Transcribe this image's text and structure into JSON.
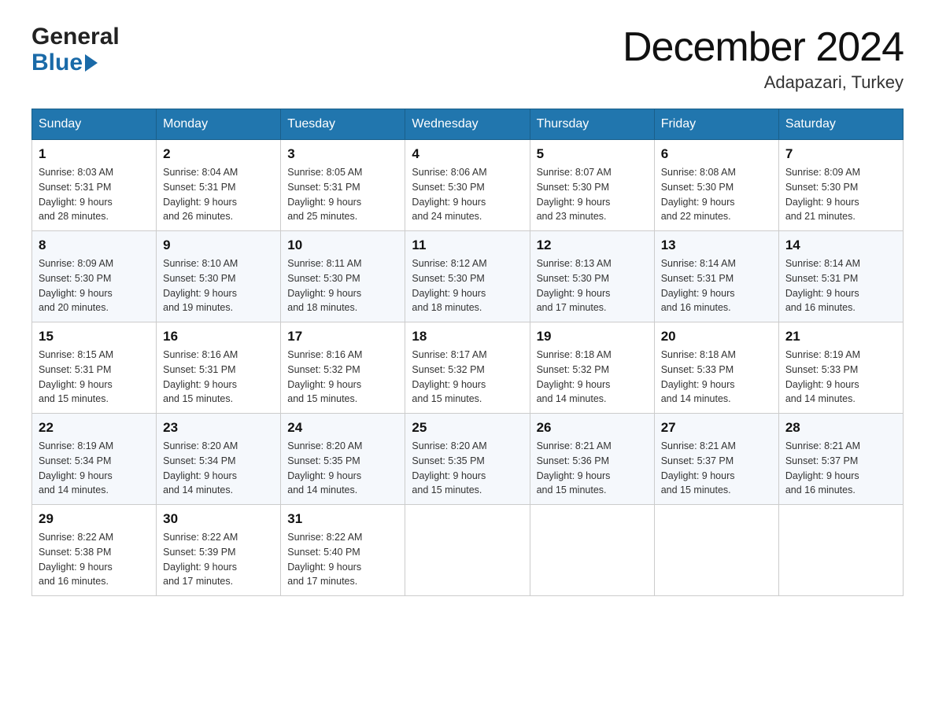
{
  "header": {
    "logo_general": "General",
    "logo_blue": "Blue",
    "month_title": "December 2024",
    "location": "Adapazari, Turkey"
  },
  "days_of_week": [
    "Sunday",
    "Monday",
    "Tuesday",
    "Wednesday",
    "Thursday",
    "Friday",
    "Saturday"
  ],
  "weeks": [
    [
      {
        "day": "1",
        "sunrise": "8:03 AM",
        "sunset": "5:31 PM",
        "daylight": "9 hours and 28 minutes."
      },
      {
        "day": "2",
        "sunrise": "8:04 AM",
        "sunset": "5:31 PM",
        "daylight": "9 hours and 26 minutes."
      },
      {
        "day": "3",
        "sunrise": "8:05 AM",
        "sunset": "5:31 PM",
        "daylight": "9 hours and 25 minutes."
      },
      {
        "day": "4",
        "sunrise": "8:06 AM",
        "sunset": "5:30 PM",
        "daylight": "9 hours and 24 minutes."
      },
      {
        "day": "5",
        "sunrise": "8:07 AM",
        "sunset": "5:30 PM",
        "daylight": "9 hours and 23 minutes."
      },
      {
        "day": "6",
        "sunrise": "8:08 AM",
        "sunset": "5:30 PM",
        "daylight": "9 hours and 22 minutes."
      },
      {
        "day": "7",
        "sunrise": "8:09 AM",
        "sunset": "5:30 PM",
        "daylight": "9 hours and 21 minutes."
      }
    ],
    [
      {
        "day": "8",
        "sunrise": "8:09 AM",
        "sunset": "5:30 PM",
        "daylight": "9 hours and 20 minutes."
      },
      {
        "day": "9",
        "sunrise": "8:10 AM",
        "sunset": "5:30 PM",
        "daylight": "9 hours and 19 minutes."
      },
      {
        "day": "10",
        "sunrise": "8:11 AM",
        "sunset": "5:30 PM",
        "daylight": "9 hours and 18 minutes."
      },
      {
        "day": "11",
        "sunrise": "8:12 AM",
        "sunset": "5:30 PM",
        "daylight": "9 hours and 18 minutes."
      },
      {
        "day": "12",
        "sunrise": "8:13 AM",
        "sunset": "5:30 PM",
        "daylight": "9 hours and 17 minutes."
      },
      {
        "day": "13",
        "sunrise": "8:14 AM",
        "sunset": "5:31 PM",
        "daylight": "9 hours and 16 minutes."
      },
      {
        "day": "14",
        "sunrise": "8:14 AM",
        "sunset": "5:31 PM",
        "daylight": "9 hours and 16 minutes."
      }
    ],
    [
      {
        "day": "15",
        "sunrise": "8:15 AM",
        "sunset": "5:31 PM",
        "daylight": "9 hours and 15 minutes."
      },
      {
        "day": "16",
        "sunrise": "8:16 AM",
        "sunset": "5:31 PM",
        "daylight": "9 hours and 15 minutes."
      },
      {
        "day": "17",
        "sunrise": "8:16 AM",
        "sunset": "5:32 PM",
        "daylight": "9 hours and 15 minutes."
      },
      {
        "day": "18",
        "sunrise": "8:17 AM",
        "sunset": "5:32 PM",
        "daylight": "9 hours and 15 minutes."
      },
      {
        "day": "19",
        "sunrise": "8:18 AM",
        "sunset": "5:32 PM",
        "daylight": "9 hours and 14 minutes."
      },
      {
        "day": "20",
        "sunrise": "8:18 AM",
        "sunset": "5:33 PM",
        "daylight": "9 hours and 14 minutes."
      },
      {
        "day": "21",
        "sunrise": "8:19 AM",
        "sunset": "5:33 PM",
        "daylight": "9 hours and 14 minutes."
      }
    ],
    [
      {
        "day": "22",
        "sunrise": "8:19 AM",
        "sunset": "5:34 PM",
        "daylight": "9 hours and 14 minutes."
      },
      {
        "day": "23",
        "sunrise": "8:20 AM",
        "sunset": "5:34 PM",
        "daylight": "9 hours and 14 minutes."
      },
      {
        "day": "24",
        "sunrise": "8:20 AM",
        "sunset": "5:35 PM",
        "daylight": "9 hours and 14 minutes."
      },
      {
        "day": "25",
        "sunrise": "8:20 AM",
        "sunset": "5:35 PM",
        "daylight": "9 hours and 15 minutes."
      },
      {
        "day": "26",
        "sunrise": "8:21 AM",
        "sunset": "5:36 PM",
        "daylight": "9 hours and 15 minutes."
      },
      {
        "day": "27",
        "sunrise": "8:21 AM",
        "sunset": "5:37 PM",
        "daylight": "9 hours and 15 minutes."
      },
      {
        "day": "28",
        "sunrise": "8:21 AM",
        "sunset": "5:37 PM",
        "daylight": "9 hours and 16 minutes."
      }
    ],
    [
      {
        "day": "29",
        "sunrise": "8:22 AM",
        "sunset": "5:38 PM",
        "daylight": "9 hours and 16 minutes."
      },
      {
        "day": "30",
        "sunrise": "8:22 AM",
        "sunset": "5:39 PM",
        "daylight": "9 hours and 17 minutes."
      },
      {
        "day": "31",
        "sunrise": "8:22 AM",
        "sunset": "5:40 PM",
        "daylight": "9 hours and 17 minutes."
      },
      null,
      null,
      null,
      null
    ]
  ],
  "labels": {
    "sunrise": "Sunrise:",
    "sunset": "Sunset:",
    "daylight": "Daylight:"
  }
}
